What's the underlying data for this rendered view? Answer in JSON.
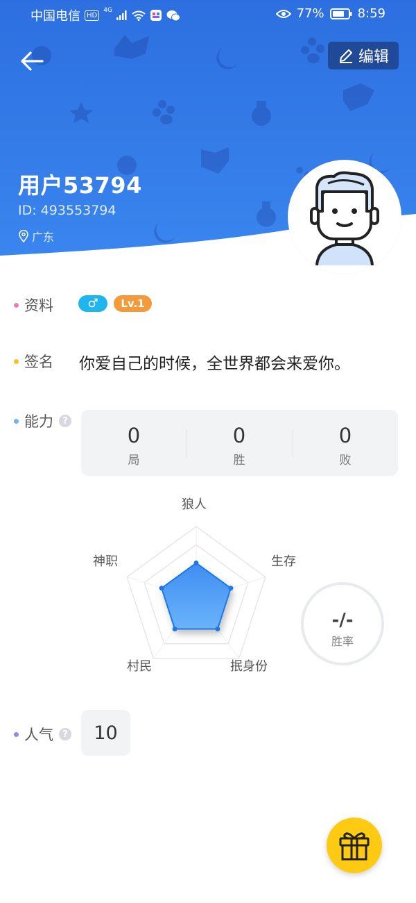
{
  "status_bar": {
    "carrier": "中国电信",
    "hd": "HD",
    "network": "4G",
    "battery": "77%",
    "time": "8:59"
  },
  "header": {
    "edit_label": "编辑",
    "username": "用户53794",
    "user_id": "ID: 493553794",
    "location": "广东"
  },
  "profile": {
    "info_label": "资料",
    "gender_symbol": "♂",
    "level": "Lv.1",
    "signature_label": "签名",
    "signature": "你爱自己的时候，全世界都会来爱你。"
  },
  "ability": {
    "label": "能力",
    "help": "?",
    "stats": [
      {
        "value": "0",
        "label": "局"
      },
      {
        "value": "0",
        "label": "胜"
      },
      {
        "value": "0",
        "label": "败"
      }
    ],
    "radar_axes": [
      "狼人",
      "生存",
      "抿身份",
      "村民",
      "神职"
    ],
    "radar_values": [
      0.5,
      0.5,
      0.5,
      0.5,
      0.5
    ],
    "win_rate_value": "-/-",
    "win_rate_label": "胜率"
  },
  "popularity": {
    "label": "人气",
    "help": "?",
    "value": "10"
  },
  "colors": {
    "header_blue": "#2d6fe0",
    "radar_fill": "#4a9bf6",
    "gender_badge": "#1fb6ef",
    "level_badge": "#f39a3a",
    "gift_button": "#fecb12"
  }
}
